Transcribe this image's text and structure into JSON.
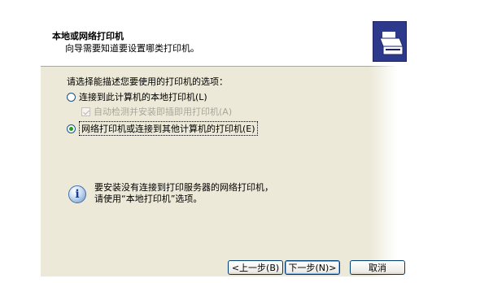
{
  "header": {
    "title": "本地或网络打印机",
    "subtitle": "向导需要知道要设置哪类打印机。"
  },
  "body": {
    "prompt": "请选择能描述您要使用的打印机的选项：",
    "options": [
      {
        "label": "连接到此计算机的本地打印机(L)",
        "checked": false
      },
      {
        "label": "自动检测并安装即插即用打印机(A)",
        "checked": true,
        "disabled": true
      },
      {
        "label": "网络打印机或连接到其他计算机的打印机(E)",
        "checked": true
      }
    ],
    "info_line1": "要安装没有连接到打印服务器的网络打印机，",
    "info_line2": "请使用“本地打印机”选项。"
  },
  "buttons": {
    "back": "<上一步(B)",
    "next": "下一步(N)>",
    "cancel": "取消"
  },
  "icons": {
    "header_logo": "printer-icon",
    "info": "info-icon"
  },
  "colors": {
    "dialog_bg": "#ece9d8",
    "header_bg": "#ffffff",
    "logo_bg": "#2d3a8c"
  }
}
